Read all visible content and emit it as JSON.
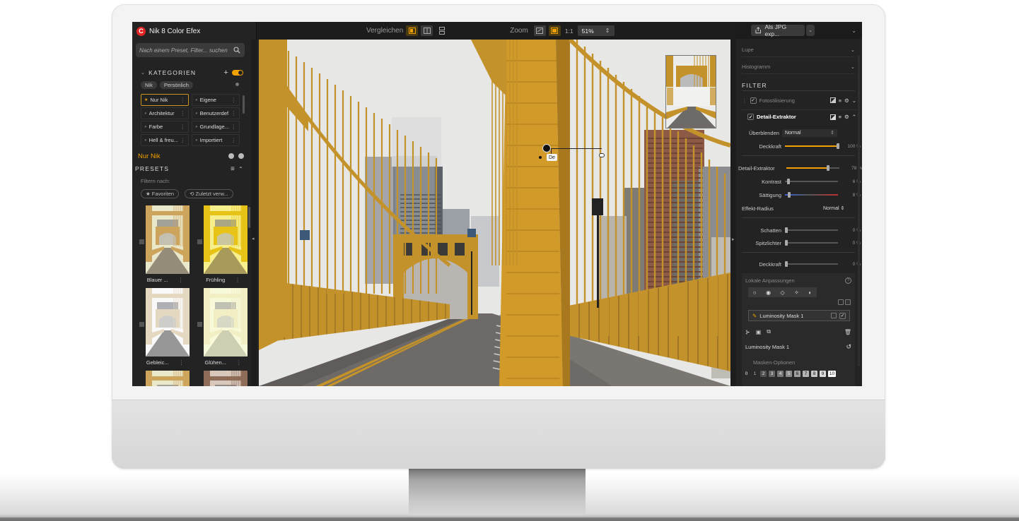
{
  "app": {
    "title": "Nik 8 Color Efex",
    "logo_letter": "C"
  },
  "search": {
    "placeholder": "Nach einem Preset, Filter... suchen"
  },
  "categories": {
    "header": "KATEGORIEN",
    "tabs": [
      "Nik",
      "Persönlich"
    ],
    "items": [
      {
        "name": "Nur Nik",
        "active": true
      },
      {
        "name": "Eigene",
        "active": false
      },
      {
        "name": "Architektur",
        "active": false
      },
      {
        "name": "Benutzerdef.",
        "active": false
      },
      {
        "name": "Farbe",
        "active": false
      },
      {
        "name": "Grundlage...",
        "active": false
      },
      {
        "name": "Hell & freu...",
        "active": false
      },
      {
        "name": "Importiert",
        "active": false
      }
    ],
    "more_glyph": "⋮"
  },
  "selected_category": "Nur Nik",
  "presets": {
    "header": "PRESETS",
    "filter_label": "Filtern nach:",
    "filter_chips": [
      "★ Favoriten",
      "⟲ Zuletzt verw..."
    ],
    "items": [
      {
        "name": "Blauer ...",
        "tone": "warm-faded"
      },
      {
        "name": "Frühling",
        "tone": "yellow"
      },
      {
        "name": "Gebleic...",
        "tone": "bleached"
      },
      {
        "name": "Glühen...",
        "tone": "glow"
      },
      {
        "name": "",
        "tone": "warm-faded"
      },
      {
        "name": "",
        "tone": "sepia"
      }
    ]
  },
  "toolbar": {
    "compare_label": "Vergleichen",
    "zoom_label": "Zoom",
    "one_to_one": "1:1",
    "zoom_value": "51%",
    "zoom_arrows": "⇕"
  },
  "control_point": {
    "tag": "De"
  },
  "export": {
    "label": "Als JPG exp..."
  },
  "panels": {
    "lupe": "Lupe",
    "histogramm": "Histogramm",
    "filter_header": "FILTER"
  },
  "filters": [
    {
      "name": "Fotostilisierung",
      "enabled": true,
      "expanded": false
    },
    {
      "name": "Detail-Extraktor",
      "enabled": true,
      "expanded": true
    }
  ],
  "detail": {
    "blend_label": "Überblenden",
    "blend_mode": "Normal",
    "params": [
      {
        "label": "Deckkraft",
        "value": 100,
        "display": "100 %",
        "orange": true
      },
      {
        "label": "Detail-Extraktor",
        "value": 78,
        "display": "78 %",
        "orange": true,
        "align": "left"
      },
      {
        "label": "Kontrast",
        "value": 6,
        "display": "6 %",
        "orange": false
      },
      {
        "label": "Sättigung",
        "value": 8,
        "display": "8 %",
        "orange": false,
        "gradient": true
      },
      {
        "label": "Schatten",
        "value": 0,
        "display": "0 %",
        "orange": false
      },
      {
        "label": "Spitzlichter",
        "value": 0,
        "display": "0 %",
        "orange": false
      },
      {
        "label": "Deckkraft",
        "value": 0,
        "display": "0 %",
        "orange": false
      }
    ],
    "radius_label": "Effekt-Radius",
    "radius_value": "Normal ⇕"
  },
  "local": {
    "header": "Lokale Anpassungen",
    "help": "?",
    "mask_row": "Luminosity Mask 1",
    "mask_name": "Luminosity Mask 1",
    "mask_options": "Masken-Optionen",
    "numbers": [
      "0",
      "1",
      "2",
      "3",
      "4",
      "5",
      "6",
      "7",
      "8",
      "9",
      "10"
    ]
  },
  "colors": {
    "accent": "#f0a000",
    "bridge": "#c4922a",
    "panel": "#232323"
  }
}
